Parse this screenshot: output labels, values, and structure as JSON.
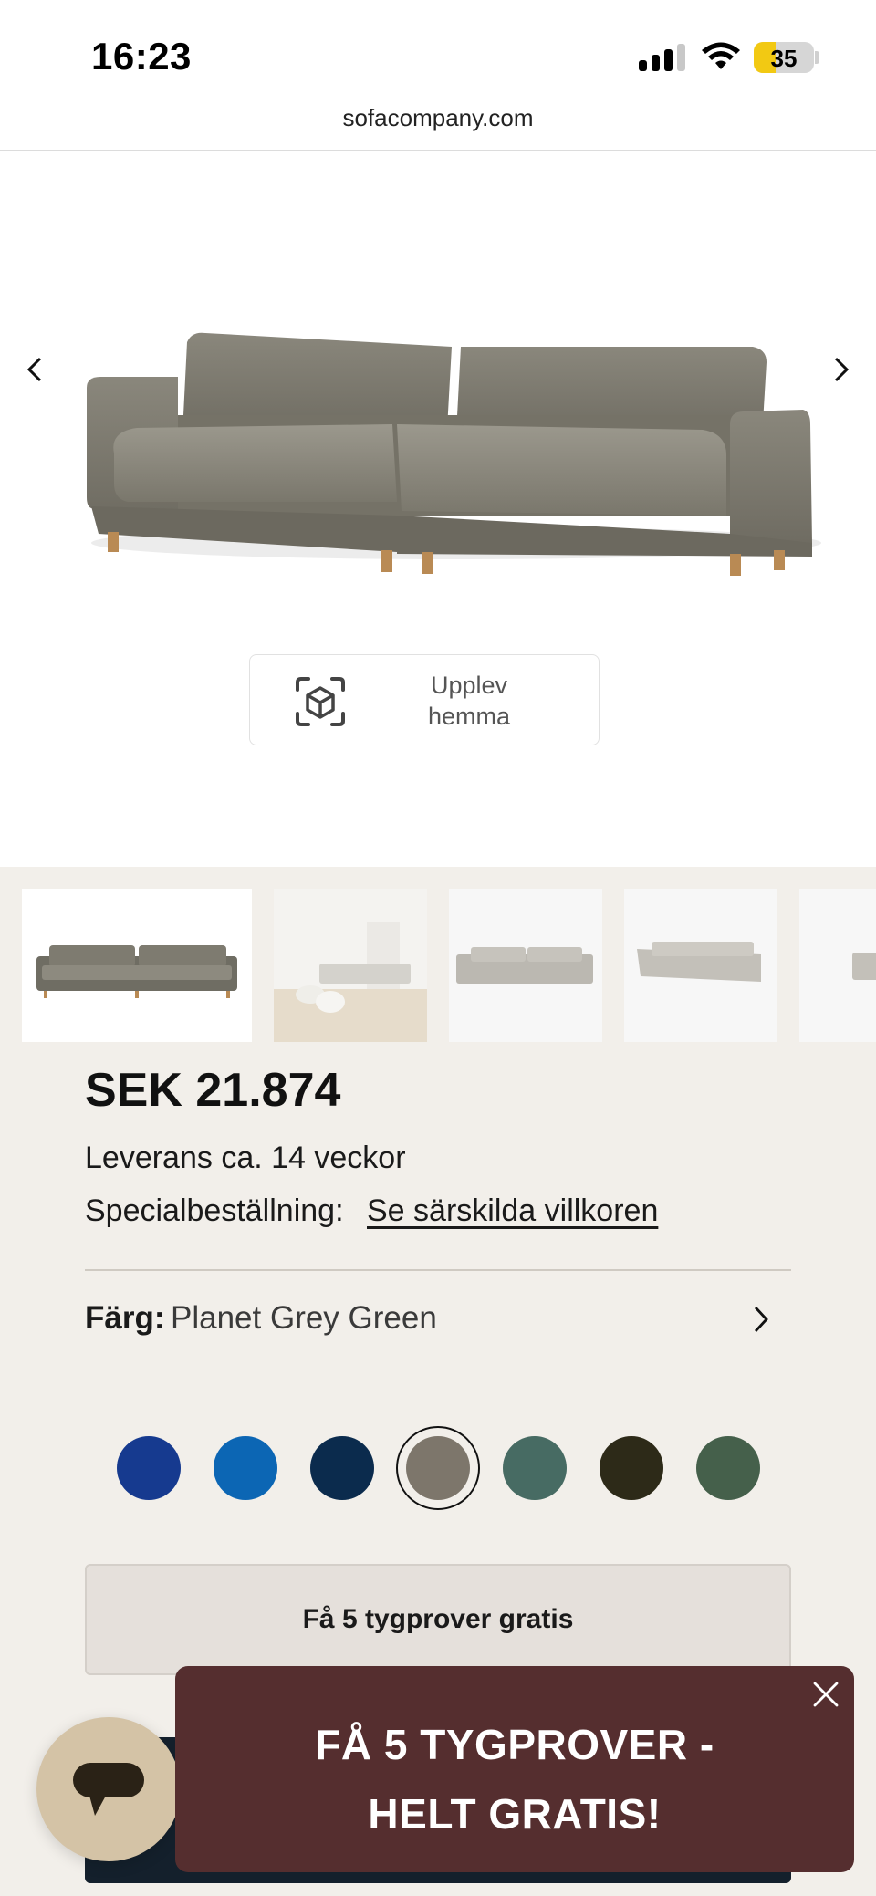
{
  "status_bar": {
    "time": "16:23",
    "battery": "35"
  },
  "browser": {
    "url": "sofacompany.com"
  },
  "hero": {
    "prev_icon": "chevron-left-icon",
    "next_icon": "chevron-right-icon",
    "ar_button": {
      "icon": "ar-cube-icon",
      "label_line1": "Upplev",
      "label_line2": "hemma"
    }
  },
  "product": {
    "price": "SEK 21.874",
    "delivery": "Leverans ca. 14 veckor",
    "special_label": "Specialbeställning:",
    "special_link": "Se särskilda villkoren",
    "color_key": "Färg:",
    "color_value": "Planet Grey Green",
    "swatches": [
      {
        "color": "#163a8f",
        "selected": false
      },
      {
        "color": "#0c66b4",
        "selected": false
      },
      {
        "color": "#0b2b4d",
        "selected": false
      },
      {
        "color": "#7d766b",
        "selected": true
      },
      {
        "color": "#476b63",
        "selected": false
      },
      {
        "color": "#2d2a18",
        "selected": false
      },
      {
        "color": "#45604b",
        "selected": false
      }
    ],
    "samples_button": "Få 5 tygprover gratis"
  },
  "promo": {
    "line1": "FÅ 5 TYGPROVER -",
    "line2": "HELT GRATIS!"
  },
  "colors": {
    "beige_bg": "#f2efea",
    "promo_bg": "#552e2f",
    "chat_bg": "#d4c3a6",
    "cart_bg": "#14202c"
  }
}
